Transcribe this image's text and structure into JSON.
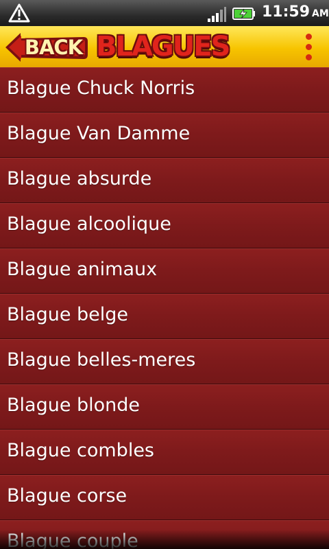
{
  "status_bar": {
    "time": "11:59",
    "ampm": "AM",
    "icons": [
      "warning-icon",
      "signal-icon",
      "battery-charging-icon"
    ]
  },
  "header": {
    "back_label": "BACK",
    "title": "BLAGUES",
    "menu_icon": "overflow-menu-icon",
    "colors": {
      "bar": "#f7c400",
      "title": "#e0241c",
      "back_button": "#c51f16"
    }
  },
  "list": {
    "items": [
      {
        "label": "Blague Chuck Norris"
      },
      {
        "label": "Blague Van Damme"
      },
      {
        "label": "Blague absurde"
      },
      {
        "label": "Blague alcoolique"
      },
      {
        "label": "Blague animaux"
      },
      {
        "label": "Blague belge"
      },
      {
        "label": "Blague belles-meres"
      },
      {
        "label": "Blague blonde"
      },
      {
        "label": "Blague combles"
      },
      {
        "label": "Blague corse"
      },
      {
        "label": "Blague couple"
      }
    ],
    "background": "#7a1a1b"
  }
}
